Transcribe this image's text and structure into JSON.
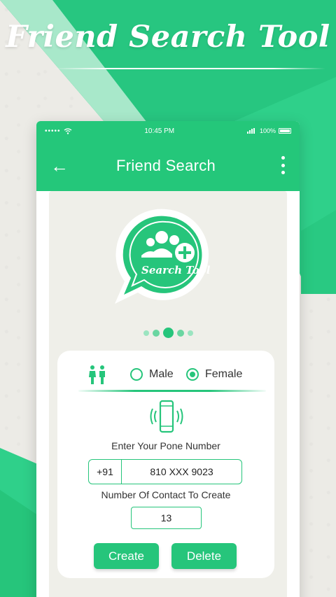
{
  "banner": {
    "title": "Friend Search Tool"
  },
  "statusbar": {
    "signal": "•••••",
    "time": "10:45 PM",
    "battery_text": "100%"
  },
  "appbar": {
    "back_icon": "←",
    "title": "Friend Search"
  },
  "logo": {
    "text": "Search Tool"
  },
  "pager": {
    "active_index": 2,
    "count": 5
  },
  "gender": {
    "options": [
      "Male",
      "Female"
    ],
    "selected": "Female"
  },
  "phone": {
    "label": "Enter Your Pone Number",
    "country_code": "+91",
    "value": "810 XXX 9023"
  },
  "contacts": {
    "label": "Number Of Contact To Create",
    "value": "13"
  },
  "buttons": {
    "create": "Create",
    "delete": "Delete"
  },
  "colors": {
    "accent": "#26c57b",
    "background": "#ecebe6"
  }
}
